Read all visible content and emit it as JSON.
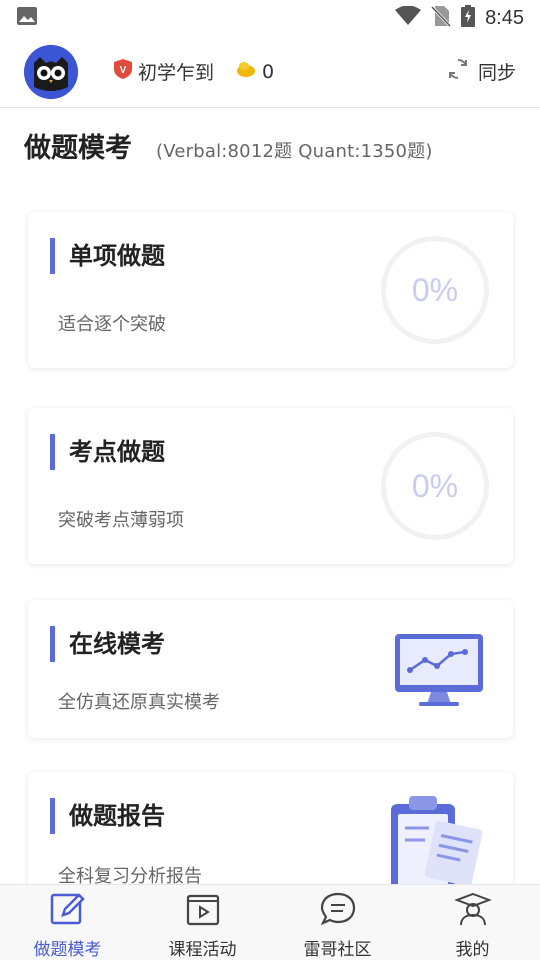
{
  "status_bar": {
    "time": "8:45",
    "icons": [
      "image-icon",
      "wifi-icon",
      "no-sim-icon",
      "battery-charging-icon"
    ]
  },
  "header": {
    "avatar_icon": "owl-avatar-icon",
    "level_label": "初学乍到",
    "coins": "0",
    "sync_label": "同步"
  },
  "page": {
    "title": "做题模考",
    "subtitle": "(Verbal:8012题   Quant:1350题)"
  },
  "cards": [
    {
      "title": "单项做题",
      "desc": "适合逐个突破",
      "progress": "0%"
    },
    {
      "title": "考点做题",
      "desc": "突破考点薄弱项",
      "progress": "0%"
    },
    {
      "title": "在线模考",
      "desc": "全仿真还原真实模考",
      "icon": "monitor-chart-icon"
    },
    {
      "title": "做题报告",
      "desc": "全科复习分析报告",
      "icon": "clipboard-report-icon"
    }
  ],
  "bottom_nav": [
    {
      "label": "做题模考",
      "icon": "edit-icon",
      "active": true
    },
    {
      "label": "课程活动",
      "icon": "video-icon",
      "active": false
    },
    {
      "label": "雷哥社区",
      "icon": "chat-icon",
      "active": false
    },
    {
      "label": "我的",
      "icon": "graduate-icon",
      "active": false
    }
  ],
  "colors": {
    "accent": "#5b6bd8",
    "active_nav": "#4a5bd4",
    "ring_text": "#c9ccf0"
  }
}
